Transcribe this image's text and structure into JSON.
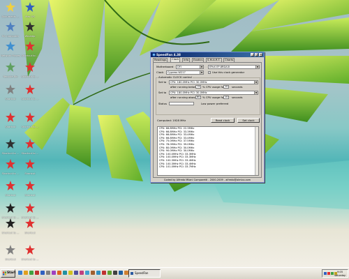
{
  "desktop": {
    "icons": [
      {
        "label": "Documents ...",
        "color": "#f0d040"
      },
      {
        "label": "Mac OS",
        "color": "#3060c0"
      },
      {
        "label": "My Computer",
        "color": "#5080c0"
      },
      {
        "label": "Winamp",
        "color": "#303030"
      },
      {
        "label": "Network Places",
        "color": "#4090d0"
      },
      {
        "label": "Shortcut to ...",
        "color": "#e03030"
      },
      {
        "label": "Recycle Bin",
        "color": "#60a060"
      },
      {
        "label": "Shortcut to ...",
        "color": "#e03030"
      },
      {
        "label": "Shortcut",
        "color": "#808080"
      },
      {
        "label": "Shortcut to ...",
        "color": "#e03030"
      },
      {
        "label": "Shortcut",
        "color": "#e03030"
      },
      {
        "label": "Shortcut to ...",
        "color": "#e03030"
      },
      {
        "label": "Shortcut to ...",
        "color": "#303030"
      },
      {
        "label": "Shortcut to ...",
        "color": "#e03030"
      },
      {
        "label": "Shortcut to ...",
        "color": "#e03030"
      },
      {
        "label": "Shortcut",
        "color": "#e03030"
      },
      {
        "label": "Shortcut",
        "color": "#e03030"
      },
      {
        "label": "Shortcut",
        "color": "#e03030"
      },
      {
        "label": "Shortcut to ...",
        "color": "#202020"
      },
      {
        "label": "Shortcut to ...",
        "color": "#e03030"
      },
      {
        "label": "Shortcut to ...",
        "color": "#202020"
      },
      {
        "label": "Shortcut",
        "color": "#e03030"
      },
      {
        "label": "Shortcut",
        "color": "#808080"
      },
      {
        "label": "Shortcut to ...",
        "color": "#e03030"
      }
    ]
  },
  "window": {
    "title": "SpeedFan 4.38",
    "min_label": "_",
    "max_label": "□",
    "close_label": "×",
    "tabs": [
      "Readings",
      "Clock",
      "Info",
      "Exotics",
      "S.M.A.R.T.",
      "Charts"
    ],
    "motherboard_label": "Motherboard",
    "motherboard_value": "DFI",
    "model_value": "EPoX EP-8RDA3I",
    "clock_label": "Clock",
    "clock_value": "Cypress W217",
    "use_generator_label": "Use this clock generator",
    "auto_group_title": "Automatic CLOCK control",
    "set_to_label_1": "Set to",
    "set_to_value_1": "CPU: 180.0MHz  PCI: 30.0MHz",
    "after_running_below_label": "after running below",
    "below_value": "75",
    "cpu_usage_label": "% CPU usage for",
    "below_seconds_value": "10",
    "seconds_label_1": "seconds",
    "set_to_label_2": "Set to",
    "set_to_value_2": "CPU: 180.0MHz  PCI: 30.0MHz",
    "after_running_above_label": "after running above",
    "above_value": "80",
    "cpu_usage_label_2": "% CPU usage for",
    "above_seconds_value": "10",
    "seconds_label_2": "seconds",
    "status_label": "Status",
    "status_value": "Low power preferred",
    "computed_label": "Computed: 1928 MHz",
    "read_clock_label": "Read clock",
    "set_clock_label": "Set clock",
    "log_rows": [
      "CPU: 66.8MHz  PCI: 22.3MHz",
      "CPU: 66.8MHz  PCI: 33.3MHz",
      "CPU: 66.8MHz  PCI: 33.4MHz",
      "CPU: 66.8MHz  PCI: 33.4MHz",
      "CPU: 75.0MHz  PCI: 37.5MHz",
      "CPU: 78.0MHz  PCI: 39.0MHz",
      "CPU: 80.0MHz  PCI: 30.0MHz",
      "CPU: 90.0MHz  PCI: 30.0MHz",
      "CPU: 100.0MHz  PCI: 33.3MHz",
      "CPU: 100.0MHz  PCI: 33.3MHz",
      "CPU: 100.3MHz  PCI: 33.4MHz",
      "CPU: 100.3MHz  PCI: 33.4MHz",
      "CPU: 101.0MHz  PCI: 33.7MHz"
    ],
    "footer": "Coded by Alfredo Milani Comparetti - 2000-2009 - alfredo@almico.com"
  },
  "taskbar": {
    "start_label": "Start",
    "task_label": "SpeedFan",
    "clock_time": "9:05",
    "clock_day": "saturday",
    "quicklaunch_colors": [
      "#3a80d0",
      "#e0a020",
      "#40a040",
      "#c03030",
      "#3060c0",
      "#808080",
      "#a040c0",
      "#e06020",
      "#2090a0",
      "#d0c020",
      "#5050a0",
      "#c04080",
      "#40a0d0",
      "#a06030",
      "#3090c0",
      "#c03030",
      "#60a030",
      "#404040",
      "#2060a0",
      "#d08030"
    ],
    "tray_colors": [
      "#3060c0",
      "#e03030",
      "#40a040",
      "#c0a020"
    ]
  }
}
